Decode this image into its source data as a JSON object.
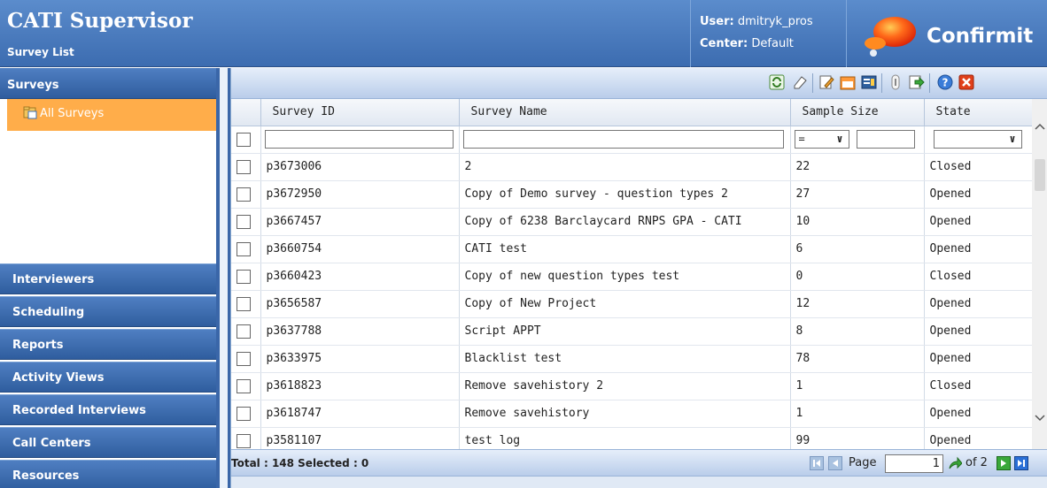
{
  "header": {
    "title": "CATI Supervisor",
    "subtitle": "Survey List",
    "user_label": "User:",
    "user_value": "dmitryk_pros",
    "center_label": "Center:",
    "center_value": "Default",
    "brand": "Confirmit"
  },
  "sidebar": {
    "section_title": "Surveys",
    "active_item": "All Surveys",
    "items": [
      {
        "label": "Interviewers"
      },
      {
        "label": "Scheduling"
      },
      {
        "label": "Reports"
      },
      {
        "label": "Activity Views"
      },
      {
        "label": "Recorded Interviews"
      },
      {
        "label": "Call Centers"
      },
      {
        "label": "Resources"
      }
    ]
  },
  "grid": {
    "columns": [
      "Survey ID",
      "Survey Name",
      "Sample Size",
      "State"
    ],
    "filter_operator": "=",
    "rows": [
      {
        "id": "p3673006",
        "name": "2",
        "size": "22",
        "state": "Closed"
      },
      {
        "id": "p3672950",
        "name": "Copy of Demo survey - question types 2",
        "size": "27",
        "state": "Opened"
      },
      {
        "id": "p3667457",
        "name": "Copy of 6238 Barclaycard RNPS GPA - CATI",
        "size": "10",
        "state": "Opened"
      },
      {
        "id": "p3660754",
        "name": "CATI test",
        "size": "6",
        "state": "Opened"
      },
      {
        "id": "p3660423",
        "name": "Copy of new question types test",
        "size": "0",
        "state": "Closed"
      },
      {
        "id": "p3656587",
        "name": "Copy of New Project",
        "size": "12",
        "state": "Opened"
      },
      {
        "id": "p3637788",
        "name": "Script APPT",
        "size": "8",
        "state": "Opened"
      },
      {
        "id": "p3633975",
        "name": "Blacklist test",
        "size": "78",
        "state": "Opened"
      },
      {
        "id": "p3618823",
        "name": "Remove savehistory 2",
        "size": "1",
        "state": "Closed"
      },
      {
        "id": "p3618747",
        "name": "Remove savehistory",
        "size": "1",
        "state": "Opened"
      },
      {
        "id": "p3581107",
        "name": "test log",
        "size": "99",
        "state": "Opened"
      }
    ]
  },
  "footer": {
    "total_text": "Total : 148 Selected : 0",
    "page_label": "Page",
    "page_value": "1",
    "of_text": "of 2"
  },
  "colors": {
    "header_blue": "#3c6cb0",
    "active_orange": "#ffad4a"
  }
}
